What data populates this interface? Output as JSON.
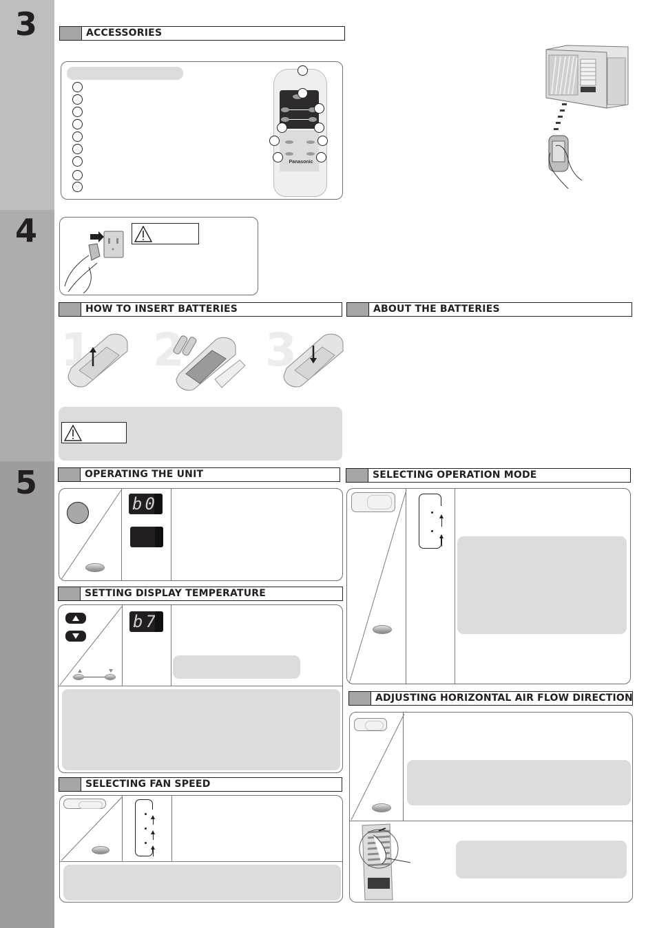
{
  "sections": [
    {
      "number": "3"
    },
    {
      "number": "4"
    },
    {
      "number": "5"
    }
  ],
  "headers": {
    "accessories": "ACCESSORIES",
    "insert_batteries": "HOW TO INSERT BATTERIES",
    "about_batteries": "ABOUT THE BATTERIES",
    "operating": "OPERATING THE UNIT",
    "operation_mode": "SELECTING OPERATION MODE",
    "display_temperature": "SETTING DISPLAY TEMPERATURE",
    "horizontal_airflow": "ADJUSTING HORIZONTAL AIR FLOW DIRECTION",
    "fan_speed": "SELECTING FAN SPEED"
  },
  "remote": {
    "brand": "Panasonic",
    "callout_count": 9
  },
  "battery_steps": [
    "1",
    "2",
    "3"
  ],
  "displays": {
    "operating_readout": "b0",
    "temperature_readout": "b7"
  },
  "icons": {
    "warning": "warning-triangle-icon",
    "up": "up-arrow-icon",
    "down": "down-arrow-icon"
  },
  "colors": {
    "sidebar_3": "#bdbdbd",
    "sidebar_4": "#adadad",
    "sidebar_5": "#9d9d9d",
    "header_square": "#a6a6a6",
    "note_fill": "#dcdcdc",
    "ink": "#231f20"
  }
}
